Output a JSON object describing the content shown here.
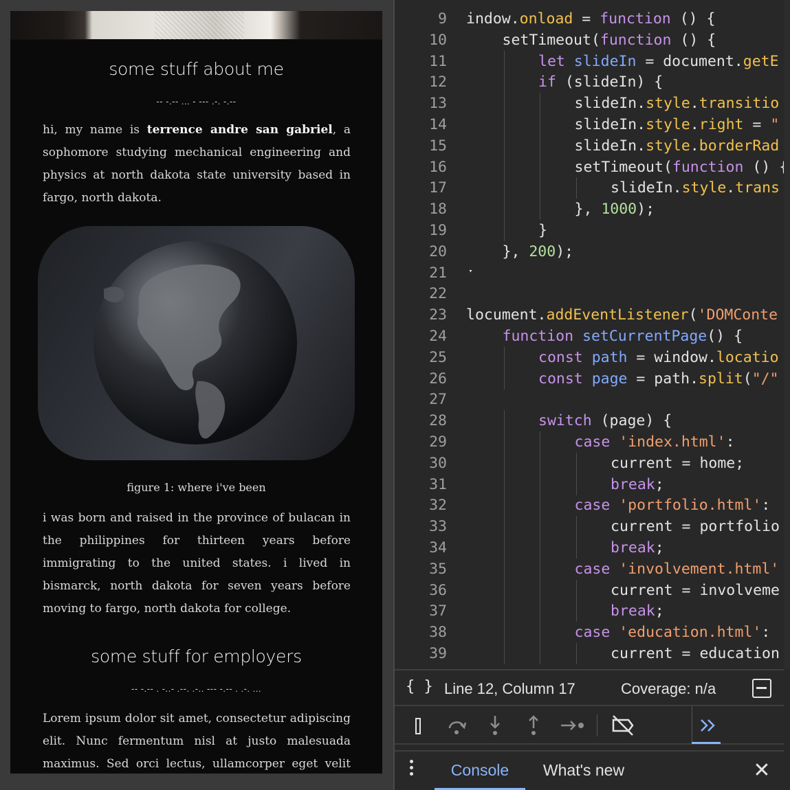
{
  "preview": {
    "about_title": "some stuff about me",
    "about_morse": "-- -.-- ... - --- .-. -.--",
    "about_para": {
      "before": "hi, my name is ",
      "name": "terrence andre san gabriel",
      "after": ", a sophomore studying mechanical engineering and physics at north dakota state university based in fargo, north dakota."
    },
    "figure_caption": "figure 1: where i've been",
    "history_para": "i was born and raised in the province of bulacan in the philippines for thirteen years before immigrating to the united states. i lived in bismarck, north dakota for seven years before moving to fargo, north dakota for college.",
    "employers_title": "some stuff for employers",
    "employers_morse": "-- -.-- . -..- .--. .-.. --- -.-- . .-. ...",
    "lorem_para": "Lorem ipsum dolor sit amet, consectetur adipiscing elit. Nunc fermentum nisl at justo malesuada maximus. Sed orci lectus, ullamcorper eget velit eu,"
  },
  "editor": {
    "lines": [
      {
        "n": "9",
        "indent": 0,
        "tokens": [
          [
            "",
            "​indow."
          ],
          [
            "prop",
            "onload"
          ],
          [
            "",
            " = "
          ],
          [
            "kw",
            "function"
          ],
          [
            "",
            " () {"
          ]
        ]
      },
      {
        "n": "10",
        "indent": 1,
        "tokens": [
          [
            "",
            "setTimeout("
          ],
          [
            "kw",
            "function"
          ],
          [
            "",
            " () {"
          ]
        ]
      },
      {
        "n": "11",
        "indent": 2,
        "tokens": [
          [
            "kw",
            "let"
          ],
          [
            "",
            " "
          ],
          [
            "var",
            "slideIn"
          ],
          [
            "",
            " = document."
          ],
          [
            "prop",
            "getE"
          ]
        ]
      },
      {
        "n": "12",
        "indent": 2,
        "tokens": [
          [
            "kw",
            "if"
          ],
          [
            "",
            " (slideIn) {"
          ]
        ]
      },
      {
        "n": "13",
        "indent": 3,
        "tokens": [
          [
            "",
            "slideIn."
          ],
          [
            "prop",
            "style"
          ],
          [
            "",
            "."
          ],
          [
            "prop",
            "transitio"
          ]
        ]
      },
      {
        "n": "14",
        "indent": 3,
        "tokens": [
          [
            "",
            "slideIn."
          ],
          [
            "prop",
            "style"
          ],
          [
            "",
            "."
          ],
          [
            "prop",
            "right"
          ],
          [
            "",
            " = "
          ],
          [
            "str",
            "\""
          ]
        ]
      },
      {
        "n": "15",
        "indent": 3,
        "tokens": [
          [
            "",
            "slideIn."
          ],
          [
            "prop",
            "style"
          ],
          [
            "",
            "."
          ],
          [
            "prop",
            "borderRad"
          ]
        ]
      },
      {
        "n": "16",
        "indent": 3,
        "tokens": [
          [
            "",
            "setTimeout("
          ],
          [
            "kw",
            "function"
          ],
          [
            "",
            " () {"
          ]
        ]
      },
      {
        "n": "17",
        "indent": 4,
        "tokens": [
          [
            "",
            "slideIn."
          ],
          [
            "prop",
            "style"
          ],
          [
            "",
            "."
          ],
          [
            "prop",
            "trans"
          ]
        ]
      },
      {
        "n": "18",
        "indent": 3,
        "tokens": [
          [
            "",
            "}, "
          ],
          [
            "num",
            "1000"
          ],
          [
            "",
            ");"
          ]
        ]
      },
      {
        "n": "19",
        "indent": 2,
        "tokens": [
          [
            "",
            "}"
          ]
        ]
      },
      {
        "n": "20",
        "indent": 1,
        "tokens": [
          [
            "",
            "}, "
          ],
          [
            "num",
            "200"
          ],
          [
            "",
            ");"
          ]
        ]
      },
      {
        "n": "21",
        "indent": 0,
        "tokens": [
          [
            "",
            "ˑ"
          ]
        ]
      },
      {
        "n": "22",
        "indent": 0,
        "tokens": []
      },
      {
        "n": "23",
        "indent": 0,
        "tokens": [
          [
            "",
            "locument."
          ],
          [
            "prop",
            "addEventListener"
          ],
          [
            "",
            "("
          ],
          [
            "str",
            "'DOMConte"
          ]
        ]
      },
      {
        "n": "24",
        "indent": 1,
        "tokens": [
          [
            "kw",
            "function"
          ],
          [
            "",
            " "
          ],
          [
            "var",
            "setCurrentPage"
          ],
          [
            "",
            "() {"
          ]
        ]
      },
      {
        "n": "25",
        "indent": 2,
        "tokens": [
          [
            "kw",
            "const"
          ],
          [
            "",
            " "
          ],
          [
            "var",
            "path"
          ],
          [
            "",
            " = window."
          ],
          [
            "prop",
            "locatio"
          ]
        ]
      },
      {
        "n": "26",
        "indent": 2,
        "tokens": [
          [
            "kw",
            "const"
          ],
          [
            "",
            " "
          ],
          [
            "var",
            "page"
          ],
          [
            "",
            " = path."
          ],
          [
            "prop",
            "split"
          ],
          [
            "",
            "("
          ],
          [
            "str",
            "\"/\""
          ]
        ]
      },
      {
        "n": "27",
        "indent": 0,
        "tokens": []
      },
      {
        "n": "28",
        "indent": 2,
        "tokens": [
          [
            "kw",
            "switch"
          ],
          [
            "",
            " (page) {"
          ]
        ]
      },
      {
        "n": "29",
        "indent": 3,
        "tokens": [
          [
            "kw",
            "case"
          ],
          [
            "",
            " "
          ],
          [
            "str",
            "'index.html'"
          ],
          [
            "",
            ":"
          ]
        ]
      },
      {
        "n": "30",
        "indent": 4,
        "tokens": [
          [
            "",
            "current = home;"
          ]
        ]
      },
      {
        "n": "31",
        "indent": 4,
        "tokens": [
          [
            "kw",
            "break"
          ],
          [
            "",
            ";"
          ]
        ]
      },
      {
        "n": "32",
        "indent": 3,
        "tokens": [
          [
            "kw",
            "case"
          ],
          [
            "",
            " "
          ],
          [
            "str",
            "'portfolio.html'"
          ],
          [
            "",
            ":"
          ]
        ]
      },
      {
        "n": "33",
        "indent": 4,
        "tokens": [
          [
            "",
            "current = portfolio"
          ]
        ]
      },
      {
        "n": "34",
        "indent": 4,
        "tokens": [
          [
            "kw",
            "break"
          ],
          [
            "",
            ";"
          ]
        ]
      },
      {
        "n": "35",
        "indent": 3,
        "tokens": [
          [
            "kw",
            "case"
          ],
          [
            "",
            " "
          ],
          [
            "str",
            "'involvement.html'"
          ]
        ]
      },
      {
        "n": "36",
        "indent": 4,
        "tokens": [
          [
            "",
            "current = involveme"
          ]
        ]
      },
      {
        "n": "37",
        "indent": 4,
        "tokens": [
          [
            "kw",
            "break"
          ],
          [
            "",
            ";"
          ]
        ]
      },
      {
        "n": "38",
        "indent": 3,
        "tokens": [
          [
            "kw",
            "case"
          ],
          [
            "",
            " "
          ],
          [
            "str",
            "'education.html'"
          ],
          [
            "",
            ":"
          ]
        ]
      },
      {
        "n": "39",
        "indent": 4,
        "tokens": [
          [
            "",
            "current = education"
          ]
        ]
      }
    ]
  },
  "status": {
    "braces_icon": "{ }",
    "position": "Line 12, Column 17",
    "coverage": "Coverage: n/a"
  },
  "debug": {
    "buttons": [
      "pause-icon",
      "step-over-icon",
      "step-into-icon",
      "step-out-icon",
      "step-icon",
      "deactivate-breakpoints-icon",
      "more-tabs-icon"
    ]
  },
  "drawer": {
    "tab_console": "Console",
    "tab_whatsnew": "What's new",
    "close": "✕"
  },
  "colors": {
    "keyword": "#c792ea",
    "property": "#f2c14e",
    "variable": "#82aaff",
    "string": "#f29e6d",
    "number": "#b5e0a0",
    "accent": "#8ab4f8"
  }
}
